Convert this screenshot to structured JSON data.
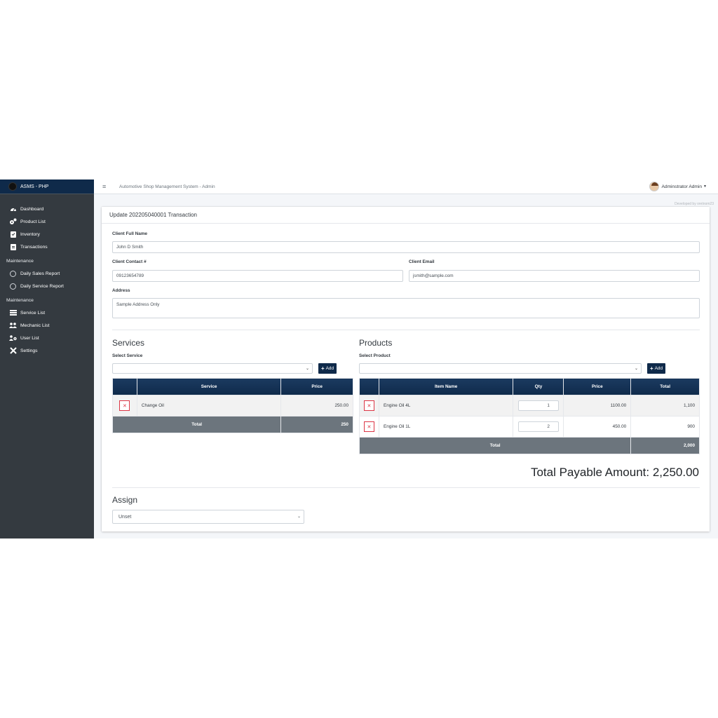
{
  "brand": {
    "name": "ASMS - PHP"
  },
  "header": {
    "system_title": "Automotive Shop Management System - Admin",
    "user_name": "Adminstrator Admin",
    "dev_credit": "Developed by oretnom23"
  },
  "sidebar": {
    "items": [
      {
        "label": "Dashboard",
        "icon": "dashboard-icon"
      },
      {
        "label": "Product List",
        "icon": "cogs-icon"
      },
      {
        "label": "Inventory",
        "icon": "clipboard-check-icon"
      },
      {
        "label": "Transactions",
        "icon": "clipboard-list-icon"
      }
    ],
    "section1_header": "Maintenance",
    "reports": [
      {
        "label": "Daily Sales Report",
        "icon": "circle-icon"
      },
      {
        "label": "Daily Service Report",
        "icon": "circle-icon"
      }
    ],
    "section2_header": "Maintenance",
    "maintenance": [
      {
        "label": "Service List",
        "icon": "list-icon"
      },
      {
        "label": "Mechanic List",
        "icon": "users-icon"
      },
      {
        "label": "User List",
        "icon": "users-cog-icon"
      },
      {
        "label": "Settings",
        "icon": "tools-icon"
      }
    ]
  },
  "form": {
    "card_title": "Update 202205040001 Transaction",
    "client_name_label": "Client Full Name",
    "client_name": "John D Smith",
    "contact_label": "Client Contact #",
    "contact": "09123654789",
    "email_label": "Client Email",
    "email": "jsmith@sample.com",
    "address_label": "Address",
    "address": "Sample Address Only"
  },
  "services": {
    "title": "Services",
    "select_label": "Select Service",
    "add_label": "Add",
    "headers": [
      "",
      "Service",
      "Price"
    ],
    "rows": [
      {
        "name": "Change Oil",
        "price": "250.00"
      }
    ],
    "total_label": "Total",
    "total": "250"
  },
  "products": {
    "title": "Products",
    "select_label": "Select Product",
    "add_label": "Add",
    "headers": [
      "",
      "Item Name",
      "Qty",
      "Price",
      "Total"
    ],
    "rows": [
      {
        "name": "Engine Oil 4L",
        "qty": "1",
        "price": "1100.00",
        "total": "1,100"
      },
      {
        "name": "Engine Oil 1L",
        "qty": "2",
        "price": "450.00",
        "total": "900"
      }
    ],
    "total_label": "Total",
    "total": "2,000"
  },
  "summary": {
    "total_payable": "Total Payable Amount: 2,250.00"
  },
  "assign": {
    "title": "Assign",
    "selected": "Unset"
  },
  "colors": {
    "primary": "#0f2a4a",
    "sidebar": "#343a40",
    "danger": "#dc3545"
  }
}
